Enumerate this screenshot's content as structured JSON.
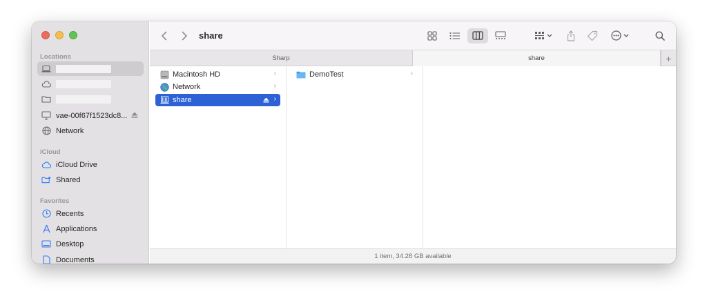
{
  "window": {
    "title": "share"
  },
  "sidebar": {
    "sections": [
      {
        "header": "Locations"
      },
      {
        "header": "iCloud"
      },
      {
        "header": "Favorites"
      }
    ],
    "locations": [
      {
        "label": "",
        "icon": "laptop-icon",
        "redacted": true,
        "selected": true
      },
      {
        "label": "",
        "icon": "cloud-icon",
        "redacted": true
      },
      {
        "label": "",
        "icon": "folder-icon",
        "redacted": true
      },
      {
        "label": "vae-00f67f1523dc8...",
        "icon": "display-icon",
        "eject": true
      },
      {
        "label": "Network",
        "icon": "globe-icon"
      }
    ],
    "icloud": [
      {
        "label": "iCloud Drive",
        "icon": "cloud-icon"
      },
      {
        "label": "Shared",
        "icon": "shared-folder-icon"
      }
    ],
    "favorites": [
      {
        "label": "Recents",
        "icon": "clock-icon"
      },
      {
        "label": "Applications",
        "icon": "applications-icon"
      },
      {
        "label": "Desktop",
        "icon": "desktop-icon"
      },
      {
        "label": "Documents",
        "icon": "document-icon"
      }
    ]
  },
  "toolbar": {
    "back": "‹",
    "forward": "›",
    "view_mode": "columns"
  },
  "tabs": [
    {
      "label": "Sharp",
      "active": false
    },
    {
      "label": "share",
      "active": true
    }
  ],
  "tab_add": "+",
  "columns": {
    "col1": [
      {
        "label": "Macintosh HD",
        "icon": "hard-drive-icon"
      },
      {
        "label": "Network",
        "icon": "network-globe-icon"
      },
      {
        "label": "share",
        "icon": "server-share-icon",
        "selected": true
      }
    ],
    "col2": [
      {
        "label": "DemoTest",
        "icon": "folder-icon"
      }
    ]
  },
  "status": {
    "text": "1 item, 34.28 GB available"
  },
  "colors": {
    "selection": "#2c62d6",
    "accent_icon": "#2f7bf5"
  }
}
